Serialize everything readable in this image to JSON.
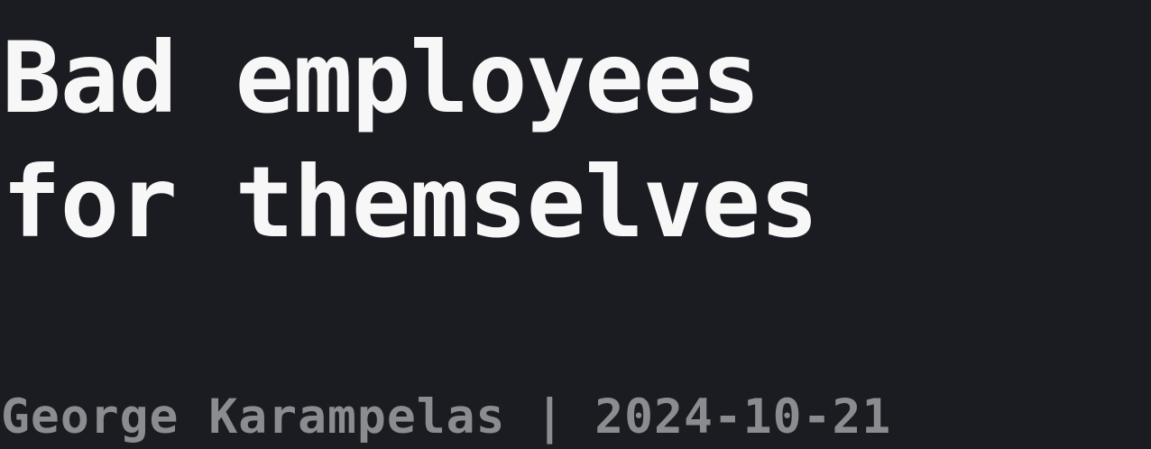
{
  "title": {
    "line1": "Bad employees",
    "line2": "for themselves"
  },
  "byline": {
    "author": "George Karampelas",
    "separator": "|",
    "date": "2024-10-21"
  },
  "colors": {
    "background": "#1b1c21",
    "title": "#f7f7f7",
    "byline": "#8b8c90"
  }
}
